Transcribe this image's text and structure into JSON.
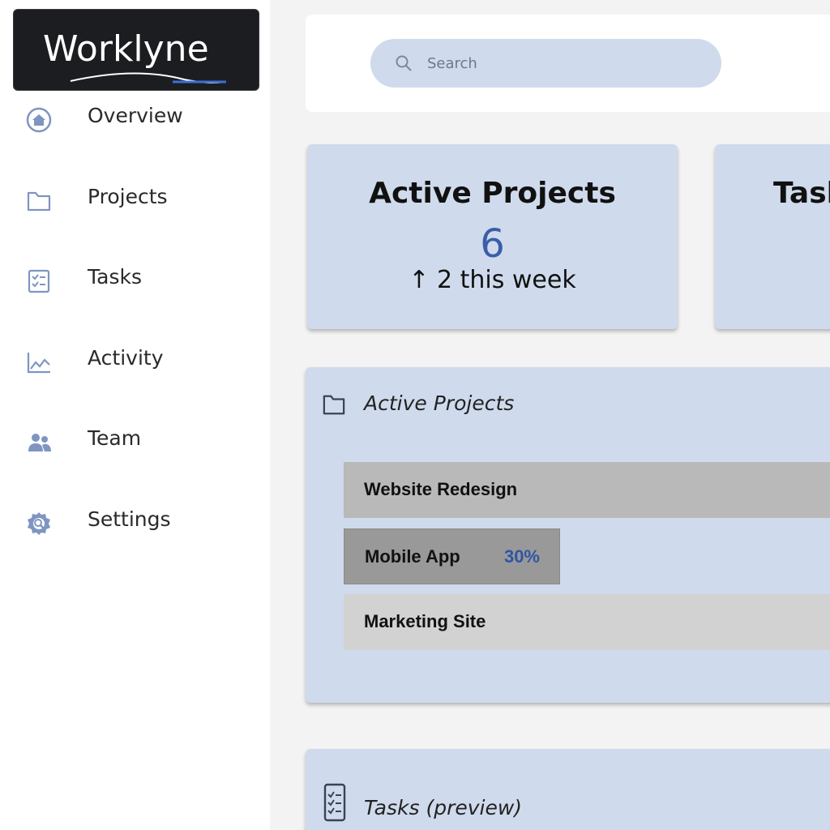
{
  "brand": {
    "name": "Worklyne"
  },
  "sidebar": {
    "items": [
      {
        "label": "Overview",
        "icon": "home-icon"
      },
      {
        "label": "Projects",
        "icon": "folder-icon"
      },
      {
        "label": "Tasks",
        "icon": "checklist-icon"
      },
      {
        "label": "Activity",
        "icon": "chart-icon"
      },
      {
        "label": "Team",
        "icon": "team-icon"
      },
      {
        "label": "Settings",
        "icon": "gear-icon"
      }
    ]
  },
  "search": {
    "placeholder": "Search"
  },
  "stats": [
    {
      "title": "Active Projects",
      "value": "6",
      "trend": "↑ 2 this week"
    },
    {
      "title": "Tasks"
    }
  ],
  "panels": {
    "active_projects": {
      "title": "Active Projects",
      "icon": "folder-icon",
      "rows": [
        {
          "name": "Website Redesign",
          "progress": 1.0,
          "color": "#b9b9b9"
        },
        {
          "name": "Mobile App",
          "percent": "30%",
          "progress": 0.3,
          "color": "#999999"
        },
        {
          "name": "Marketing Site",
          "progress": 1.0,
          "color": "#d2d2d2"
        }
      ]
    },
    "tasks_preview": {
      "title": "Tasks (preview)",
      "icon": "checklist-icon"
    }
  },
  "colors": {
    "accent": "#3a5ea8",
    "card_bg": "#cfdbec",
    "icon": "#7f95c1"
  }
}
